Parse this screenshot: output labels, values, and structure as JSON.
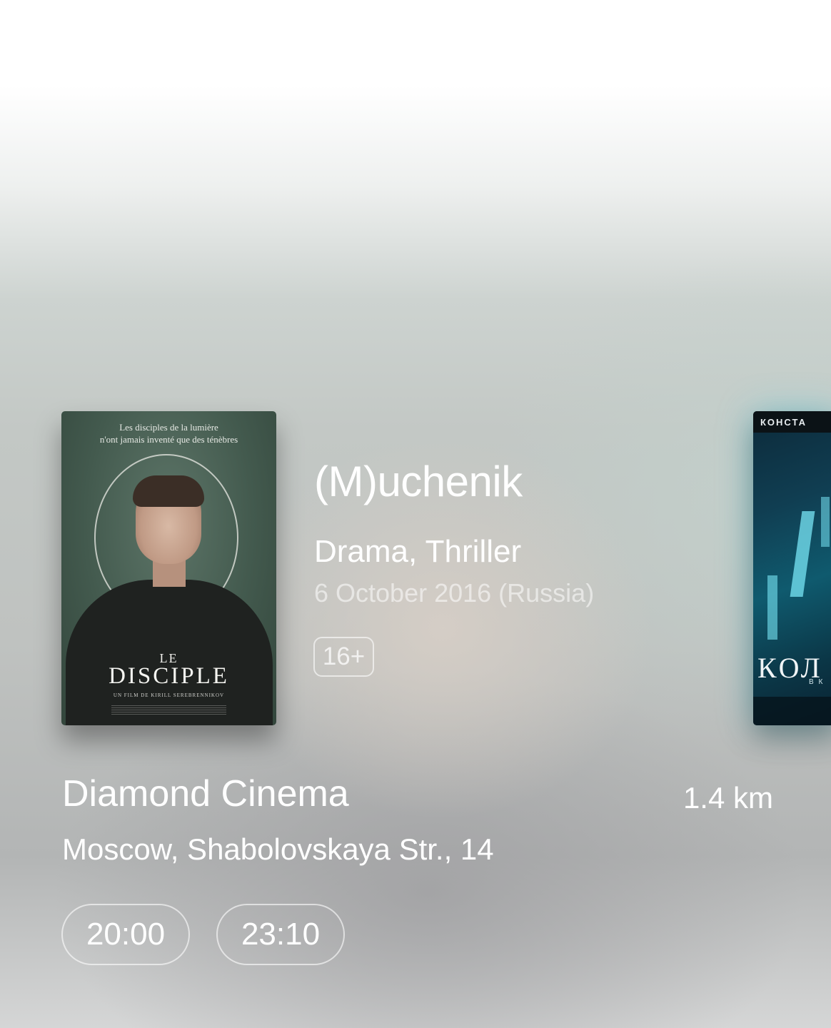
{
  "featured_movie": {
    "title": "(M)uchenik",
    "genres": "Drama, Thriller",
    "release": "6 October 2016 (Russia)",
    "age_rating": "16+",
    "poster": {
      "tagline_line1": "Les disciples de la lumière",
      "tagline_line2": "n'ont jamais inventé que des ténèbres",
      "title_small": "LE",
      "title_large": "DISCIPLE",
      "director": "UN FILM DE KIRILL SEREBRENNIKOV"
    }
  },
  "next_poster": {
    "top_text": "КОНСТА",
    "title_text": "КОЛ",
    "sub_text": "В К"
  },
  "cinema": {
    "name": "Diamond Cinema",
    "distance": "1.4 km",
    "address": "Moscow, Shabolovskaya Str., 14"
  },
  "showtimes": [
    "20:00",
    "23:10"
  ],
  "colors": {
    "text": "#ffffff",
    "muted_text": "rgba(255,255,255,0.55)",
    "pill_border": "rgba(255,255,255,0.6)"
  }
}
